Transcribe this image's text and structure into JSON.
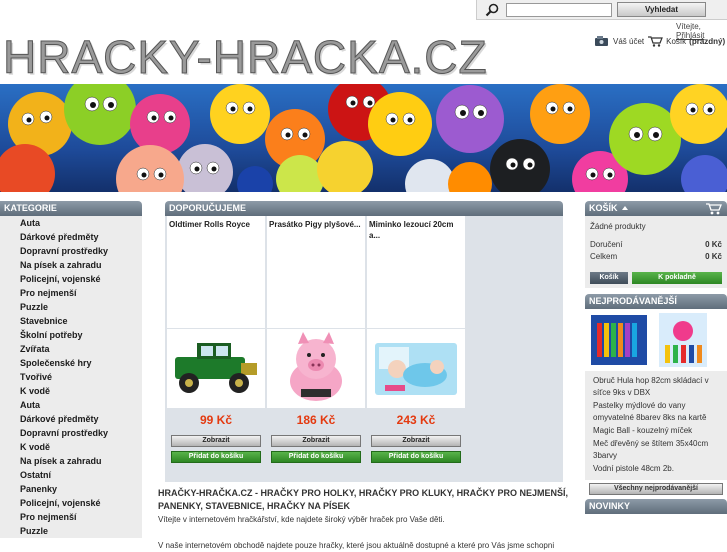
{
  "search": {
    "placeholder": "",
    "button_label": "Vyhledat"
  },
  "greeting": {
    "text": "Vítejte,",
    "login_link": "Přihlásit"
  },
  "logo_text": "HRACKY-HRACKA.CZ",
  "account": {
    "my_account": "Váš účet",
    "cart_label": "Košík",
    "cart_status": "(prázdný)"
  },
  "categories": {
    "heading": "KATEGORIE",
    "items": [
      "Auta",
      "Dárkové předměty",
      "Dopravní prostředky",
      "Na písek a zahradu",
      "Policejní, vojenské",
      "Pro nejmenší",
      "Puzzle",
      "Stavebnice",
      "Školní potřeby",
      "Zvířata",
      "Společenské hry",
      "Tvořivé",
      "K vodě",
      "Auta",
      "Dárkové předměty",
      "Dopravní prostředky",
      "K vodě",
      "Na písek a zahradu",
      "Ostatní",
      "Panenky",
      "Policejní, vojenské",
      "Pro nejmenší",
      "Puzzle"
    ]
  },
  "featured": {
    "heading": "DOPORUČUJEME",
    "products": [
      {
        "name": "Oldtimer Rolls Royce",
        "price": "99 Kč",
        "show": "Zobrazit",
        "add": "Přidat do košíku"
      },
      {
        "name": "Prasátko Pigy plyšové...",
        "price": "186 Kč",
        "show": "Zobrazit",
        "add": "Přidat do košíku"
      },
      {
        "name": "Miminko lezoucí 20cm a...",
        "price": "243 Kč",
        "show": "Zobrazit",
        "add": "Přidat do košíku"
      }
    ]
  },
  "intro": {
    "title": "HRAČKY-HRAČKA.CZ - HRAČKY PRO HOLKY, HRAČKY PRO KLUKY, HRAČKY PRO NEJMENŠÍ, PANENKY, STAVEBNICE, HRAČKY NA PÍSEK",
    "welcome": "Vítejte v internetovém hračkářství, kde najdete široký výběr hraček pro Vaše děti.",
    "paragraph": "V naše internetovém obchodě najdete pouze hračky, které jsou aktuálně dostupné a které pro Vás jsme schopni"
  },
  "cart": {
    "heading": "KOŠÍK",
    "empty": "Žádné produkty",
    "delivery_label": "Doručení",
    "delivery_value": "0 Kč",
    "total_label": "Celkem",
    "total_value": "0 Kč",
    "cart_button": "Košík",
    "checkout_button": "K pokladně"
  },
  "bestsellers": {
    "heading": "NEJPRODÁVANĚJŠÍ",
    "items": [
      "Obruč Hula hop 82cm skládací v síťce 9ks v DBX",
      "Pastelky mýdlové do vany omyvatelné 8barev 8ks na kartě",
      "Magic Ball - kouzelný míček",
      "Meč dřevěný se štítem 35x40cm 3barvy",
      "Vodní pistole 48cm 2b."
    ],
    "all_button": "Všechny nejprodávanější"
  },
  "news": {
    "heading": "NOVINKY"
  }
}
